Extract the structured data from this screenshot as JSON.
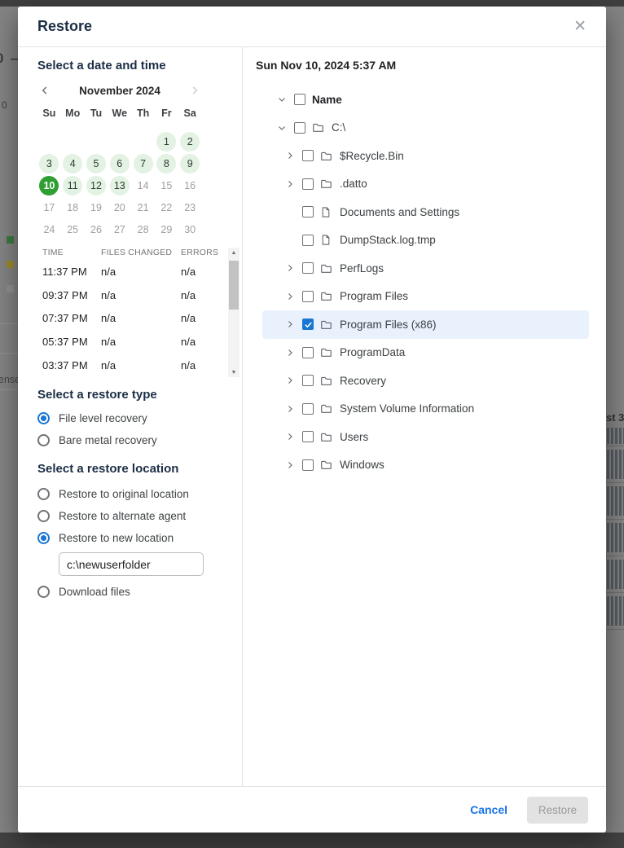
{
  "dialog": {
    "title": "Restore",
    "close_glyph": "✕"
  },
  "backdrop_fragments": {
    "top_left_partial": "0 —",
    "left_number_partial": "0",
    "left_bottom_partial": "ense",
    "right_partial": "st 3"
  },
  "date_panel": {
    "heading": "Select a date and time",
    "calendar": {
      "month_label": "November 2024",
      "weekdays": [
        "Su",
        "Mo",
        "Tu",
        "We",
        "Th",
        "Fr",
        "Sa"
      ],
      "weeks": [
        [
          "",
          "",
          "",
          "",
          "",
          "1",
          "2"
        ],
        [
          "3",
          "4",
          "5",
          "6",
          "7",
          "8",
          "9"
        ],
        [
          "10",
          "11",
          "12",
          "13",
          "14",
          "15",
          "16"
        ],
        [
          "17",
          "18",
          "19",
          "20",
          "21",
          "22",
          "23"
        ],
        [
          "24",
          "25",
          "26",
          "27",
          "28",
          "29",
          "30"
        ]
      ],
      "available_days": [
        1,
        2,
        3,
        4,
        5,
        6,
        7,
        8,
        9,
        11,
        12,
        13
      ],
      "selected_day": 10,
      "disabled_days": [
        14,
        15,
        16,
        17,
        18,
        19,
        20,
        21,
        22,
        23,
        24,
        25,
        26,
        27,
        28,
        29,
        30
      ]
    },
    "time_table": {
      "columns": [
        "TIME",
        "FILES CHANGED",
        "ERRORS"
      ],
      "rows": [
        {
          "time": "11:37 PM",
          "files_changed": "n/a",
          "errors": "n/a"
        },
        {
          "time": "09:37 PM",
          "files_changed": "n/a",
          "errors": "n/a"
        },
        {
          "time": "07:37 PM",
          "files_changed": "n/a",
          "errors": "n/a"
        },
        {
          "time": "05:37 PM",
          "files_changed": "n/a",
          "errors": "n/a"
        },
        {
          "time": "03:37 PM",
          "files_changed": "n/a",
          "errors": "n/a"
        }
      ]
    }
  },
  "restore_type": {
    "heading": "Select a restore type",
    "options": [
      {
        "label": "File level recovery",
        "selected": true
      },
      {
        "label": "Bare metal recovery",
        "selected": false
      }
    ]
  },
  "restore_location": {
    "heading": "Select a restore location",
    "options": [
      {
        "label": "Restore to original location",
        "selected": false,
        "has_input": false
      },
      {
        "label": "Restore to alternate agent",
        "selected": false,
        "has_input": false
      },
      {
        "label": "Restore to new location",
        "selected": true,
        "has_input": true
      },
      {
        "label": "Download files",
        "selected": false,
        "has_input": false
      }
    ],
    "new_location_value": "c:\\newuserfolder"
  },
  "file_tree": {
    "snapshot_label": "Sun Nov 10, 2024 5:37 AM",
    "header": {
      "label": "Name",
      "chevron": "down",
      "checked": false
    },
    "rows": [
      {
        "label": "C:\\",
        "icon": "folder",
        "chevron": "down",
        "checked": false,
        "highlighted": false,
        "level": 0
      },
      {
        "label": "$Recycle.Bin",
        "icon": "folder",
        "chevron": "right",
        "checked": false,
        "highlighted": false,
        "level": 1
      },
      {
        "label": ".datto",
        "icon": "folder",
        "chevron": "right",
        "checked": false,
        "highlighted": false,
        "level": 1
      },
      {
        "label": "Documents and Settings",
        "icon": "file",
        "chevron": "none",
        "checked": false,
        "highlighted": false,
        "level": 1
      },
      {
        "label": "DumpStack.log.tmp",
        "icon": "file",
        "chevron": "none",
        "checked": false,
        "highlighted": false,
        "level": 1
      },
      {
        "label": "PerfLogs",
        "icon": "folder",
        "chevron": "right",
        "checked": false,
        "highlighted": false,
        "level": 1
      },
      {
        "label": "Program Files",
        "icon": "folder",
        "chevron": "right",
        "checked": false,
        "highlighted": false,
        "level": 1
      },
      {
        "label": "Program Files (x86)",
        "icon": "folder",
        "chevron": "right",
        "checked": true,
        "highlighted": true,
        "level": 1
      },
      {
        "label": "ProgramData",
        "icon": "folder",
        "chevron": "right",
        "checked": false,
        "highlighted": false,
        "level": 1
      },
      {
        "label": "Recovery",
        "icon": "folder",
        "chevron": "right",
        "checked": false,
        "highlighted": false,
        "level": 1
      },
      {
        "label": "System Volume Information",
        "icon": "folder",
        "chevron": "right",
        "checked": false,
        "highlighted": false,
        "level": 1
      },
      {
        "label": "Users",
        "icon": "folder",
        "chevron": "right",
        "checked": false,
        "highlighted": false,
        "level": 1
      },
      {
        "label": "Windows",
        "icon": "folder",
        "chevron": "right",
        "checked": false,
        "highlighted": false,
        "level": 1
      }
    ]
  },
  "footer": {
    "cancel_label": "Cancel",
    "restore_label": "Restore",
    "restore_enabled": false
  },
  "colors": {
    "accent_blue": "#1976d2",
    "link_blue": "#1a73e8",
    "selected_day_green": "#2f9e33",
    "available_day_green": "#e3f2e2",
    "tree_highlight_blue": "#e9f1fd",
    "heading_navy": "#1c2e46",
    "legend_green": "#3c7a40",
    "legend_olive": "#9d8b2e",
    "legend_gray": "#8e9194"
  }
}
